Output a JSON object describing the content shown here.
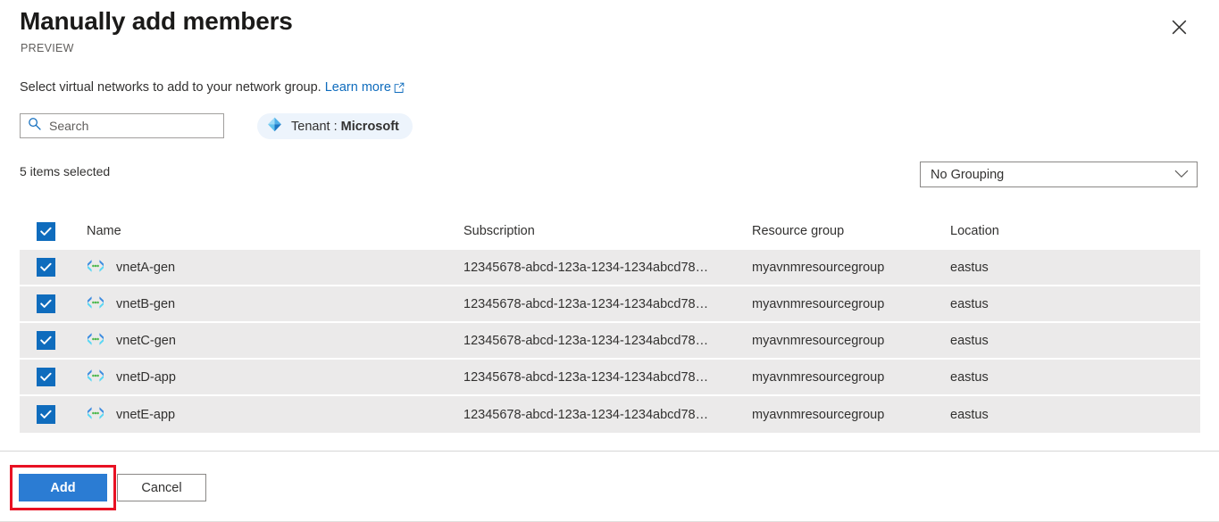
{
  "panel": {
    "title": "Manually add members",
    "preview_tag": "PREVIEW",
    "close_icon": "close-icon",
    "description_text": "Select virtual networks to add to your network group.",
    "learn_more_label": "Learn more",
    "external_link_icon": "external-link-icon"
  },
  "search": {
    "placeholder": "Search",
    "value": "",
    "icon": "search-icon"
  },
  "tenant_filter": {
    "icon": "azure-ad-tenant-icon",
    "prefix": "Tenant : ",
    "value": "Microsoft"
  },
  "toolbar": {
    "selected_count_label": "5 items selected",
    "grouping_value": "No Grouping",
    "grouping_chevron_icon": "chevron-down-icon"
  },
  "table": {
    "select_all_checked": true,
    "columns": [
      "Name",
      "Subscription",
      "Resource group",
      "Location"
    ],
    "rows": [
      {
        "checked": true,
        "icon": "virtual-network-icon",
        "name": "vnetA-gen",
        "subscription": "12345678-abcd-123a-1234-1234abcd78…",
        "resource_group": "myavnmresourcegroup",
        "location": "eastus"
      },
      {
        "checked": true,
        "icon": "virtual-network-icon",
        "name": "vnetB-gen",
        "subscription": "12345678-abcd-123a-1234-1234abcd78…",
        "resource_group": "myavnmresourcegroup",
        "location": "eastus"
      },
      {
        "checked": true,
        "icon": "virtual-network-icon",
        "name": "vnetC-gen",
        "subscription": "12345678-abcd-123a-1234-1234abcd78…",
        "resource_group": "myavnmresourcegroup",
        "location": "eastus"
      },
      {
        "checked": true,
        "icon": "virtual-network-icon",
        "name": "vnetD-app",
        "subscription": "12345678-abcd-123a-1234-1234abcd78…",
        "resource_group": "myavnmresourcegroup",
        "location": "eastus"
      },
      {
        "checked": true,
        "icon": "virtual-network-icon",
        "name": "vnetE-app",
        "subscription": "12345678-abcd-123a-1234-1234abcd78…",
        "resource_group": "myavnmresourcegroup",
        "location": "eastus"
      }
    ]
  },
  "footer": {
    "add_label": "Add",
    "cancel_label": "Cancel"
  },
  "colors": {
    "accent_blue": "#0f6cbd",
    "primary_button": "#2b7cd3",
    "link_blue": "#0f6cbd",
    "annotation_red": "#e81123",
    "row_selected_bg": "#ebeaea",
    "tenant_pill_bg": "#edf4fc"
  }
}
